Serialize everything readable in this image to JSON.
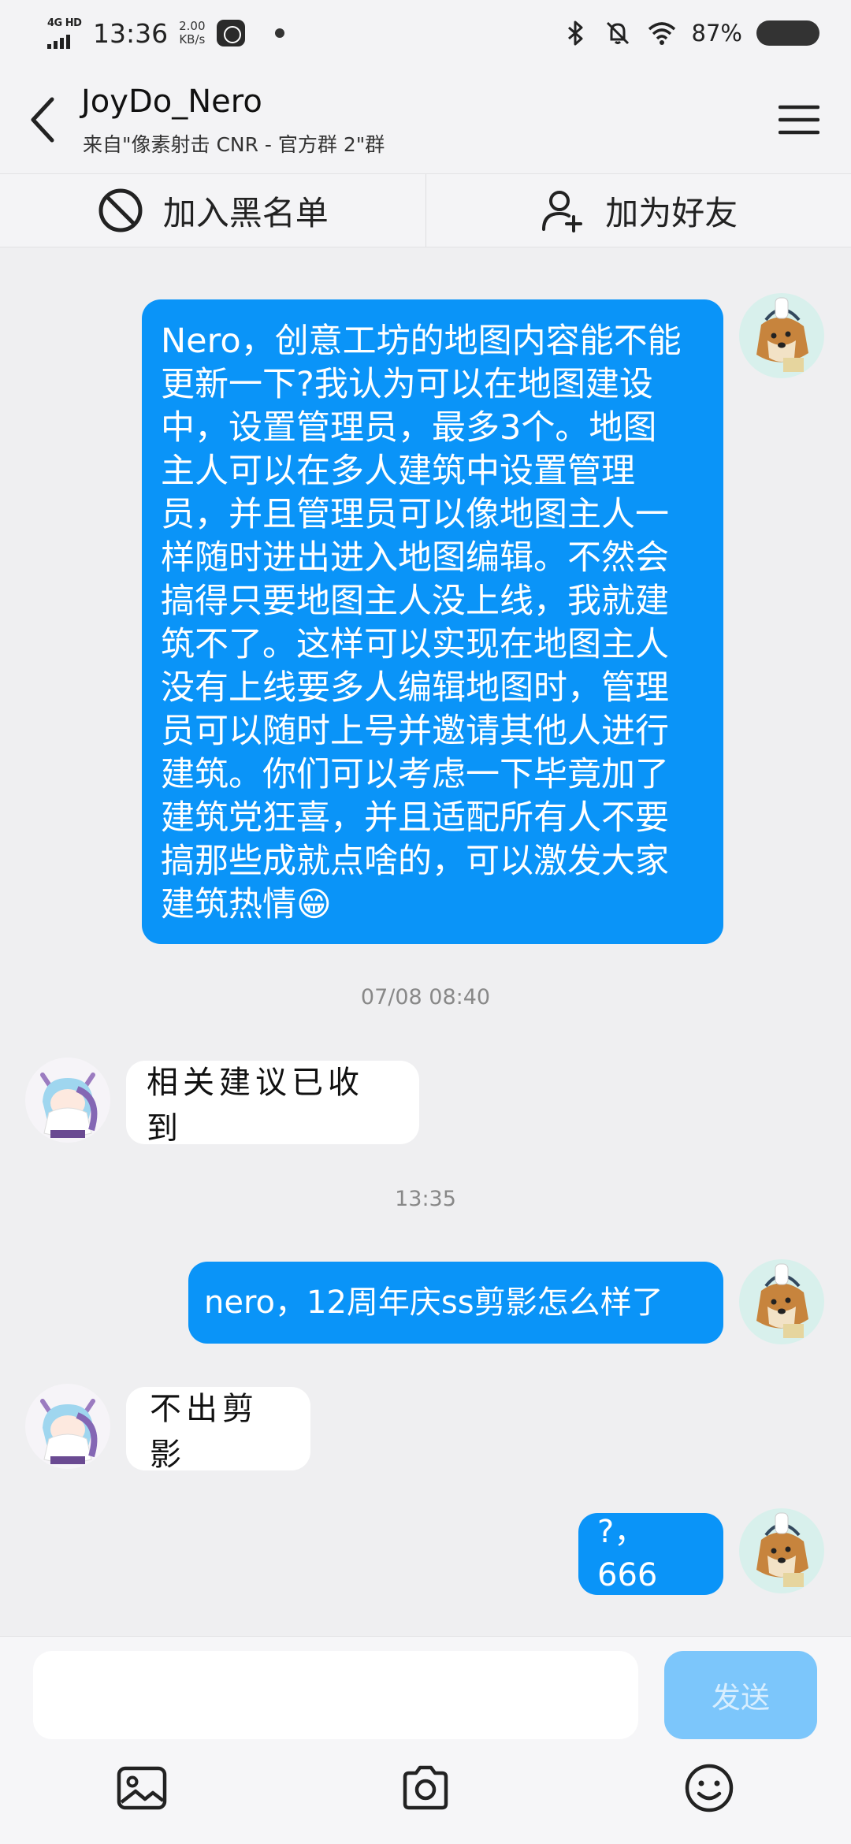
{
  "status_bar": {
    "network": "4G HD",
    "time": "13:36",
    "speed_value": "2.00",
    "speed_unit": "KB/s",
    "battery": "87%",
    "icons": [
      "signal-icon",
      "app-icon",
      "bluetooth-icon",
      "mute-icon",
      "wifi-icon",
      "battery-icon"
    ]
  },
  "header": {
    "title": "JoyDo_Nero",
    "subtitle": "来自\"像素射击 CNR - 官方群 2\"群",
    "icons": [
      "back-icon",
      "menu-icon"
    ]
  },
  "actions": {
    "block_label": "加入黑名单",
    "add_friend_label": "加为好友"
  },
  "messages": {
    "m1_lines": [
      "Nero，创意工坊的地图内容能不能",
      "更新一下?我认为可以在地图建设",
      "中，设置管理员，最多3个。地图",
      "主人可以在多人建筑中设置管理",
      "员，并且管理员可以像地图主人一",
      "样随时进出进入地图编辑。不然会",
      "搞得只要地图主人没上线，我就建",
      "筑不了。这样可以实现在地图主人",
      "没有上线要多人编辑地图时，管理",
      "员可以随时上号并邀请其他人进行",
      "建筑。你们可以考虑一下毕竟加了",
      "建筑党狂喜，并且适配所有人不要",
      "搞那些成就点啥的，可以激发大家",
      "建筑热情"
    ],
    "m1_emoji": "😁",
    "ts1": "07/08 08:40",
    "m2": "相关建议已收到",
    "ts2": "13:35",
    "m3": "nero，12周年庆ss剪影怎么样了",
    "m4": "不出剪影",
    "m5": "?，666"
  },
  "composer": {
    "input_value": "",
    "input_placeholder": "",
    "send_label": "发送",
    "tools": [
      "image-icon",
      "camera-icon",
      "emoji-icon"
    ]
  }
}
